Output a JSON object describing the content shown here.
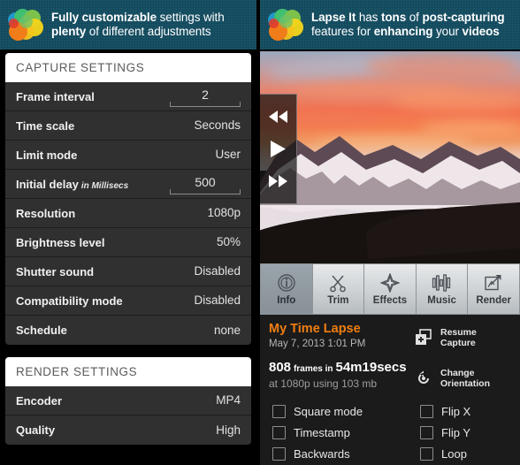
{
  "banners": {
    "left": {
      "logo_icon": "lapse-it-petals-logo",
      "line1_bold": "Fully customizable",
      "line1_rest": " settings with",
      "line2_rest": "plenty",
      "line2_bold": " of different adjustments"
    },
    "right": {
      "logo_icon": "lapse-it-petals-logo",
      "line1_bold": "Lapse It",
      "line1_mid": " has ",
      "line1_bold2": "tons",
      "line1_mid2": " of ",
      "line1_bold3": "post-capturing",
      "line2_a": "features for ",
      "line2_bold": "enhancing",
      "line2_b": " your ",
      "line2_bold2": "videos"
    }
  },
  "capture_settings": {
    "header": "CAPTURE SETTINGS",
    "rows": [
      {
        "label": "Frame interval",
        "sublabel": "",
        "value": "2",
        "type": "field"
      },
      {
        "label": "Time scale",
        "sublabel": "",
        "value": "Seconds",
        "type": "text"
      },
      {
        "label": "Limit mode",
        "sublabel": "",
        "value": "User",
        "type": "text"
      },
      {
        "label": "Initial delay",
        "sublabel": "in Millisecs",
        "value": "500",
        "type": "field"
      },
      {
        "label": "Resolution",
        "sublabel": "",
        "value": "1080p",
        "type": "text"
      },
      {
        "label": "Brightness level",
        "sublabel": "",
        "value": "50%",
        "type": "text"
      },
      {
        "label": "Shutter sound",
        "sublabel": "",
        "value": "Disabled",
        "type": "text"
      },
      {
        "label": "Compatibility mode",
        "sublabel": "",
        "value": "Disabled",
        "type": "text"
      },
      {
        "label": "Schedule",
        "sublabel": "",
        "value": "none",
        "type": "text"
      }
    ]
  },
  "render_settings": {
    "header": "RENDER SETTINGS",
    "rows": [
      {
        "label": "Encoder",
        "sublabel": "",
        "value": "MP4",
        "type": "text"
      },
      {
        "label": "Quality",
        "sublabel": "",
        "value": "High",
        "type": "text"
      }
    ]
  },
  "preview": {
    "description": "snowy mountain valley at sunset with orange sky",
    "controls": [
      {
        "name": "rewind-button",
        "icon": "rewind-icon"
      },
      {
        "name": "play-button",
        "icon": "play-icon"
      },
      {
        "name": "fast-forward-button",
        "icon": "fast-forward-icon"
      }
    ]
  },
  "tabs": [
    {
      "label": "Info",
      "icon": "info-icon",
      "selected": true
    },
    {
      "label": "Trim",
      "icon": "scissors-icon",
      "selected": false
    },
    {
      "label": "Effects",
      "icon": "sparkle-icon",
      "selected": false
    },
    {
      "label": "Music",
      "icon": "equalizer-icon",
      "selected": false
    },
    {
      "label": "Render",
      "icon": "export-icon",
      "selected": false
    }
  ],
  "project": {
    "title": "My Time Lapse",
    "date": "May 7, 2013 1:01 PM",
    "frames_count": "808",
    "frames_word": "frames in",
    "duration": "54m19secs",
    "detail": "at 1080p using 103 mb",
    "title_color": "#f07e12"
  },
  "actions": [
    {
      "label_line1": "Resume",
      "label_line2": "Capture",
      "icon": "add-layer-icon"
    },
    {
      "label_line1": "Change",
      "label_line2": "Orientation",
      "icon": "rotate-icon"
    }
  ],
  "checkboxes": [
    {
      "label": "Square mode",
      "checked": false,
      "column": "left"
    },
    {
      "label": "Flip X",
      "checked": false,
      "column": "right"
    },
    {
      "label": "Timestamp",
      "checked": false,
      "column": "left"
    },
    {
      "label": "Flip Y",
      "checked": false,
      "column": "right"
    },
    {
      "label": "Backwards",
      "checked": false,
      "column": "left"
    },
    {
      "label": "Loop",
      "checked": false,
      "column": "right"
    }
  ]
}
